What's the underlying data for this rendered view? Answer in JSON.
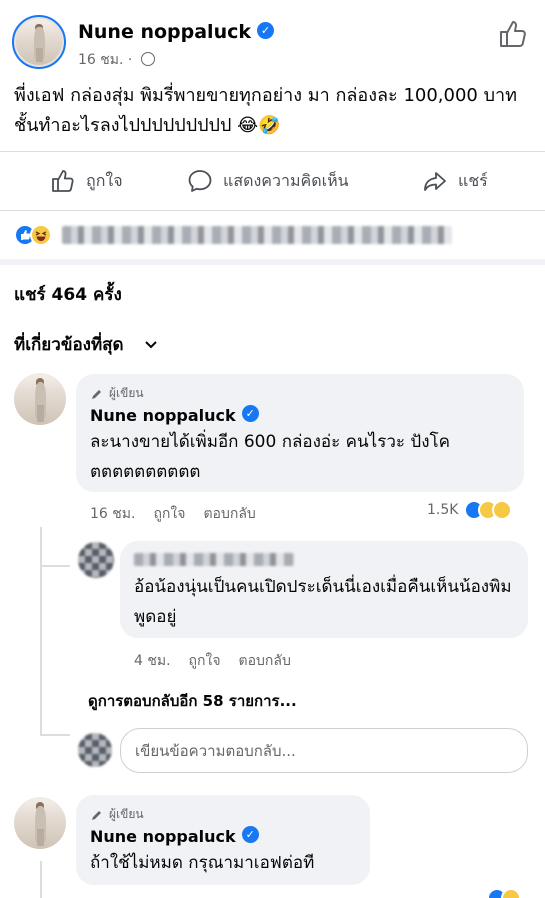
{
  "post": {
    "author": "Nune noppaluck",
    "time": "16 ชม.",
    "text": "พี่งเอฟ กล่องสุ่ม พิมรี่พายขายทุกอย่าง มา กล่องละ 100,000 บาท ชั้นทำอะไรลงไปปปปปปปปป 😂🤣"
  },
  "actions": {
    "like": "ถูกใจ",
    "comment": "แสดงความคิดเห็น",
    "share": "แชร์"
  },
  "shares_text": "แชร์ 464 ครั้ง",
  "sort_label": "ที่เกี่ยวข้องที่สุด",
  "comments": [
    {
      "badge": "ผู้เขียน",
      "name": "Nune noppaluck",
      "text": "ละนางขายได้เพิ่มอีก 600 กล่องอ่ะ คนไรวะ ปังโคตตตตตตตตตต",
      "time": "16 ชม.",
      "like": "ถูกใจ",
      "reply": "ตอบกลับ",
      "reaction_count": "1.5K"
    },
    {
      "text": "อ้อน้องนุ่นเป็นคนเปิดประเด็นนี่เองเมื่อคืนเห็นน้องพิมพูดอยู่",
      "time": "4 ชม.",
      "like": "ถูกใจ",
      "reply": "ตอบกลับ"
    },
    {
      "badge": "ผู้เขียน",
      "name": "Nune noppaluck",
      "text": "ถ้าใช้ไม่หมด กรุณามาเอฟต่อที"
    }
  ],
  "view_more_replies": "ดูการตอบกลับอีก 58 รายการ...",
  "reply_placeholder": "เขียนข้อความตอบกลับ...",
  "colors": {
    "facebook_blue": "#1877f2",
    "bubble_bg": "#f0f2f5",
    "secondary_text": "#65676b"
  }
}
